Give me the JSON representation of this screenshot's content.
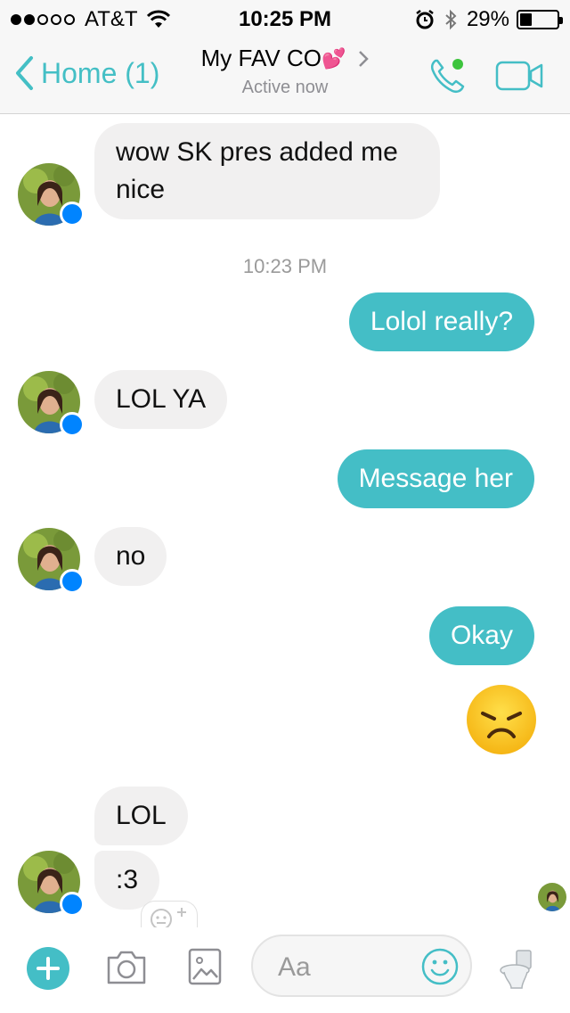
{
  "status_bar": {
    "carrier": "AT&T",
    "time": "10:25 PM",
    "battery_percent": "29%",
    "battery_level": 0.29,
    "signal_bars_filled": 2,
    "signal_bars_total": 5
  },
  "nav": {
    "back_label": "Home (1)",
    "title": "My FAV CO",
    "title_emoji": "💕",
    "subtitle": "Active now"
  },
  "messages": [
    {
      "direction": "incoming",
      "lines": [
        "wow SK pres added me",
        "nice"
      ]
    },
    {
      "timestamp": "10:23 PM"
    },
    {
      "direction": "outgoing",
      "text": "Lolol really?"
    },
    {
      "direction": "incoming",
      "text": "LOL YA"
    },
    {
      "direction": "outgoing",
      "text": "Message her"
    },
    {
      "direction": "incoming",
      "text": "no"
    },
    {
      "direction": "outgoing",
      "text": "Okay"
    },
    {
      "direction": "outgoing",
      "emoji": "disappointed-face"
    },
    {
      "direction": "incoming",
      "text": "LOL"
    },
    {
      "direction": "incoming",
      "text": ":3"
    }
  ],
  "composer": {
    "placeholder": "Aa"
  },
  "colors": {
    "accent": "#44bec6",
    "incoming_bubble": "#f1f0f0",
    "messenger_badge": "#0084ff",
    "active_dot": "#3dc43d"
  },
  "icons": [
    "wifi-icon",
    "alarm-icon",
    "bluetooth-icon",
    "battery-icon",
    "back-chevron-icon",
    "title-chevron-icon",
    "phone-icon",
    "video-icon",
    "plus-icon",
    "camera-icon",
    "gallery-icon",
    "smiley-icon",
    "toilet-icon",
    "messenger-badge-icon",
    "add-reaction-icon"
  ]
}
